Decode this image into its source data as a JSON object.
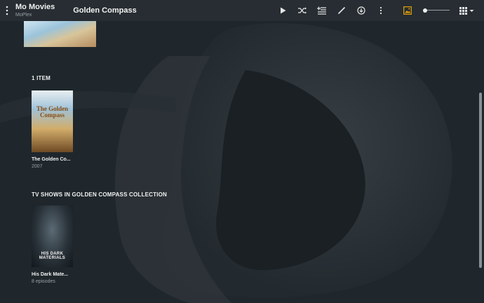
{
  "header": {
    "app_name": "Mo Movies",
    "server_name": "MoPlex",
    "page_title": "Golden Compass",
    "accent_color": "#e5a00d"
  },
  "toolbar": {
    "icons": [
      "play-icon",
      "shuffle-icon",
      "add-to-queue-icon",
      "edit-icon",
      "download-icon",
      "more-icon",
      "background-image-icon",
      "size-slider",
      "grid-view-icon"
    ],
    "size_slider_value": 0
  },
  "sections": [
    {
      "heading": "1 ITEM",
      "items": [
        {
          "title": "The Golden Co...",
          "subtitle": "2007",
          "poster_text": "The Golden Compass"
        }
      ]
    },
    {
      "heading": "TV SHOWS IN GOLDEN COMPASS COLLECTION",
      "items": [
        {
          "title": "His Dark Mate...",
          "subtitle": "8 episodes",
          "poster_text": "HIS DARK MATERIALS"
        }
      ]
    }
  ]
}
